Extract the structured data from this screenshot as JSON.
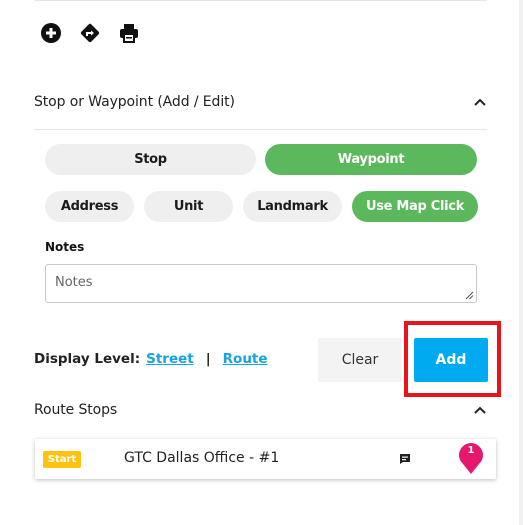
{
  "toolbar": {
    "icons": [
      "add-icon",
      "directions-icon",
      "print-icon"
    ]
  },
  "stop_section": {
    "title": "Stop or Waypoint (Add / Edit)",
    "type_options": [
      {
        "label": "Stop",
        "selected": false
      },
      {
        "label": "Waypoint",
        "selected": true
      }
    ],
    "input_modes": [
      {
        "label": "Address",
        "selected": false
      },
      {
        "label": "Unit",
        "selected": false
      },
      {
        "label": "Landmark",
        "selected": false
      },
      {
        "label": "Use Map Click",
        "selected": true
      }
    ],
    "notes_label": "Notes",
    "notes_placeholder": "Notes",
    "notes_value": ""
  },
  "display_level": {
    "label": "Display Level:",
    "options": [
      "Street",
      "Route"
    ],
    "separator": "|"
  },
  "actions": {
    "clear_label": "Clear",
    "add_label": "Add"
  },
  "route_stops": {
    "title": "Route Stops",
    "items": [
      {
        "badge": "Start",
        "name": "GTC Dallas Office - #1",
        "number": "1"
      }
    ]
  },
  "colors": {
    "selected_green": "#5cb85c",
    "add_blue": "#00aaf0",
    "link_blue": "#16a3e0",
    "highlight_red": "#e8141b",
    "start_yellow": "#ffc20e",
    "pin_magenta": "#e6186d"
  }
}
